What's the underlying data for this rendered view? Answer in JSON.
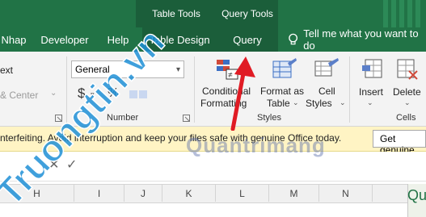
{
  "title_bar": {
    "context_tabs": {
      "table_tools": "Table Tools",
      "query_tools": "Query Tools"
    }
  },
  "tabs": {
    "nhap": "Nhap",
    "developer": "Developer",
    "help": "Help",
    "table_design": "Table Design",
    "query": "Query",
    "tell_me": "Tell me what you want to do"
  },
  "ribbon": {
    "alignment_partial": {
      "text": "ext",
      "merge_center": "& Center"
    },
    "number": {
      "format_value": "General",
      "group_label": "Number",
      "currency": "$",
      "percent": "%"
    },
    "styles": {
      "conditional": [
        "Conditional",
        "Formatting"
      ],
      "format_as_table": [
        "Format as",
        "Table"
      ],
      "cell_styles": [
        "Cell",
        "Styles"
      ],
      "group_label": "Styles"
    },
    "cells": {
      "insert": "Insert",
      "delete": "Delete",
      "group_label": "Cells"
    }
  },
  "warning_bar": {
    "message": "nterfeiting. Avoid interruption and keep your files safe with genuine Office today.",
    "button": "Get genuine"
  },
  "columns": [
    "H",
    "I",
    "J",
    "K",
    "L",
    "M",
    "N"
  ],
  "query_pane": {
    "label": "Qu"
  },
  "watermarks": {
    "site": "Truongtin.vn",
    "overlay": "Quantrimang"
  },
  "colors": {
    "excel_green": "#217346",
    "context_tab": "#1b5e3a",
    "warning_bg": "#fff4c4",
    "arrow_red": "#e01b24"
  }
}
